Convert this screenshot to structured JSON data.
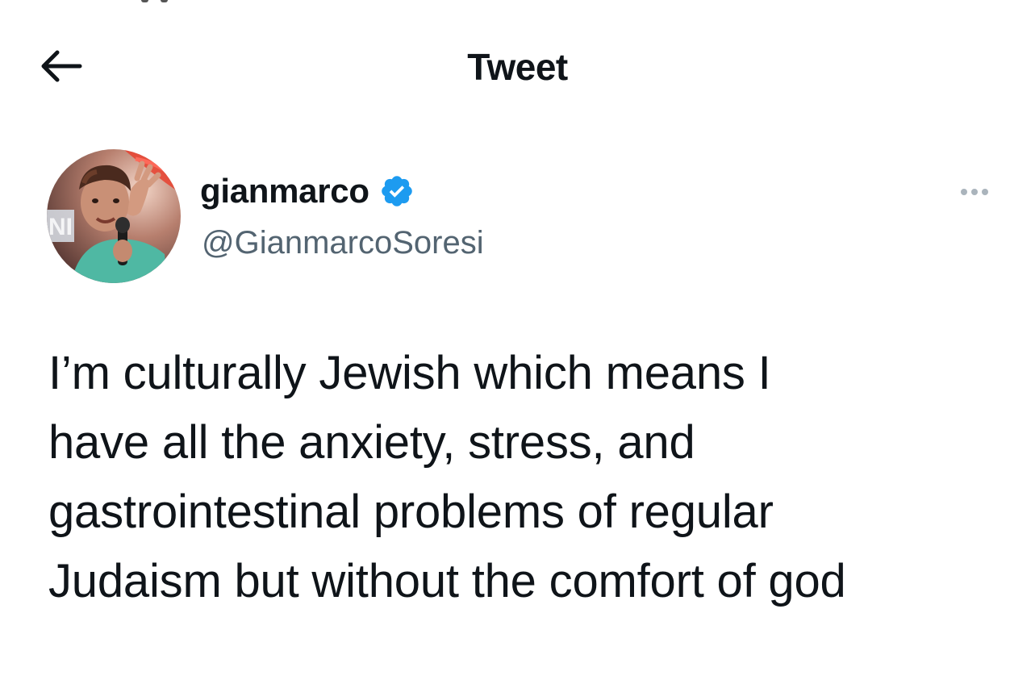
{
  "header": {
    "title": "Tweet",
    "back_icon": "arrow-left-icon"
  },
  "author": {
    "display_name": "gianmarco",
    "handle": "@GianmarcoSoresi",
    "verified": true,
    "verified_icon": "verified-badge-icon",
    "verified_color": "#1d9bf0",
    "more_icon": "more-horizontal-icon"
  },
  "tweet": {
    "text": "I’m culturally Jewish which means I\nhave all the anxiety, stress, and\ngastrointestinal problems of regular\nJudaism but without the comfort of god"
  }
}
